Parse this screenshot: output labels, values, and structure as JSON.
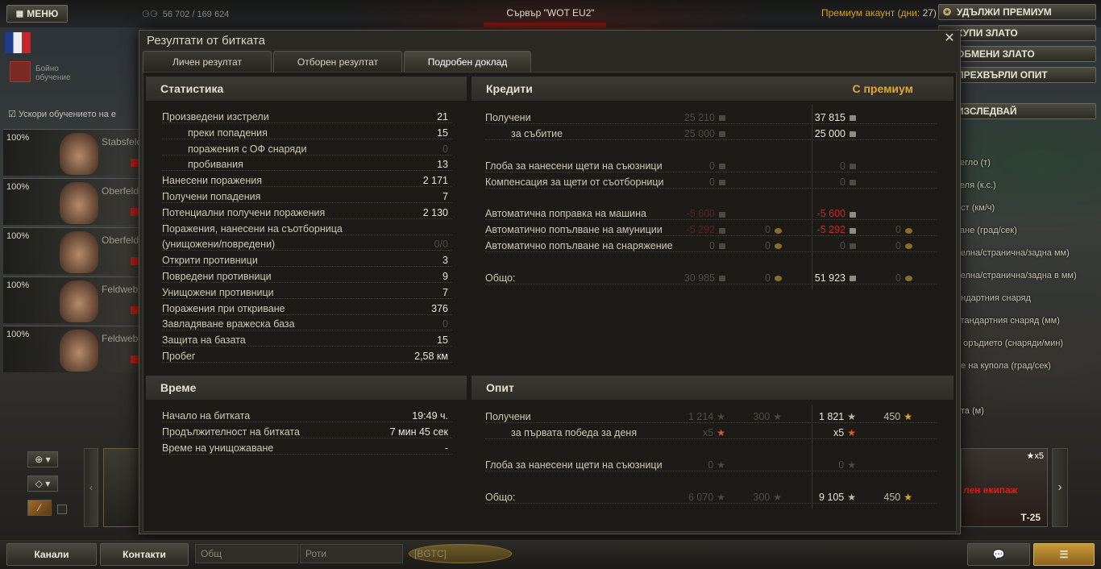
{
  "topbar": {
    "menu_label": "МЕНЮ",
    "stat_text": "56 702 / 169 624",
    "server": "Сървър \"WOT EU2\"",
    "premium_label": "Премиум акаунт (дни:",
    "premium_days": "27)"
  },
  "right_buttons": [
    "УДЪЛЖИ ПРЕМИУМ",
    "КУПИ ЗЛАТО",
    "ОБМЕНИ ЗЛАТО",
    "ПРЕХВЪРЛИ ОПИТ",
    "ИЗСЛЕДВАЙ"
  ],
  "right_items": [
    "Тегло (т)",
    "Мощност на двигателя (к.с.)",
    "Максимална скорост (км/ч)",
    "Завиване на шасито (град/сек)",
    "Бронировка (челна/странична/задна мм)",
    "Бронировка купол (челна/странична/задна в мм)",
    "Стандартни щети от стандартния снаряд",
    "Пробиване на стандартния снаряд (мм)",
    "Скорострелност на оръдието (снаряди/мин)",
    "Скорост на въртене на купола (град/сек)",
    "Обхват (м)"
  ],
  "right_items_visible": [
    "тегло (т)",
    "теля (к.с.)",
    "ост (км/ч)",
    "тане (град/сек)",
    "челна/странична/задна мм)",
    "челна/странична/задна в мм)",
    "андартния снаряд",
    "стандартния снаряд (мм)",
    "а оръдието (снаряди/мин)",
    "не на купола (град/сек)",
    "ата (м)"
  ],
  "left": {
    "training_label": "Бойно обучение",
    "speedup_label": "Ускори обучението на е",
    "crew": [
      {
        "pct": "100%",
        "rank": "Stabsfeldw"
      },
      {
        "pct": "100%",
        "rank": "Oberfeldw"
      },
      {
        "pct": "100%",
        "rank": "Oberfeldw"
      },
      {
        "pct": "100%",
        "rank": "Feldweb"
      },
      {
        "pct": "100%",
        "rank": "Feldweb"
      }
    ]
  },
  "dialog": {
    "title": "Резултати от битката",
    "tabs": [
      "Личен резултат",
      "Отборен резултат",
      "Подробен доклад"
    ],
    "active_tab": 2,
    "statistics": {
      "header": "Статистика",
      "rows": [
        {
          "label": "Произведени изстрели",
          "value": "21",
          "indent": false,
          "dim": false
        },
        {
          "label": "преки попадения",
          "value": "15",
          "indent": true,
          "dim": false
        },
        {
          "label": "поражения с ОФ снаряди",
          "value": "0",
          "indent": true,
          "dim": true
        },
        {
          "label": "пробивания",
          "value": "13",
          "indent": true,
          "dim": false
        },
        {
          "label": "Нанесени поражения",
          "value": "2 171",
          "indent": false,
          "dim": false
        },
        {
          "label": "Получени попадения",
          "value": "7",
          "indent": false,
          "dim": false
        },
        {
          "label": "Потенциални получени поражения",
          "value": "2 130",
          "indent": false,
          "dim": false
        },
        {
          "label": "Поражения, нанесени на съотборница",
          "value": "",
          "indent": false,
          "dim": false
        },
        {
          "label": "(унищожени/повредени)",
          "value": "0/0",
          "indent": false,
          "dim": true
        },
        {
          "label": "Открити противници",
          "value": "3",
          "indent": false,
          "dim": false
        },
        {
          "label": "Повредени противници",
          "value": "9",
          "indent": false,
          "dim": false
        },
        {
          "label": "Унищожени противници",
          "value": "7",
          "indent": false,
          "dim": false
        },
        {
          "label": "Поражения при откриване",
          "value": "376",
          "indent": false,
          "dim": false
        },
        {
          "label": "Завладяване вражеска база",
          "value": "0",
          "indent": false,
          "dim": true
        },
        {
          "label": "Защита на базата",
          "value": "15",
          "indent": false,
          "dim": false
        },
        {
          "label": "Пробег",
          "value": "2,58 км",
          "indent": false,
          "dim": false
        }
      ]
    },
    "time": {
      "header": "Време",
      "rows": [
        {
          "label": "Начало на битката",
          "value": "19:49 ч."
        },
        {
          "label": "Продължителност на битката",
          "value": "7 мин 45 сек"
        },
        {
          "label": "Време на унищожаване",
          "value": "-"
        }
      ]
    },
    "credits": {
      "header": "Кредити",
      "premium_header": "С премиум",
      "rows": [
        {
          "label": "Получени",
          "indent": false,
          "std": "25 210",
          "std_style": "dim",
          "std_gold": "",
          "prem": "37 815",
          "prem_style": "",
          "prem_gold": ""
        },
        {
          "label": "за събитие",
          "indent": true,
          "std": "25 000",
          "std_style": "dim",
          "std_gold": "",
          "prem": "25 000",
          "prem_style": "",
          "prem_gold": ""
        },
        {
          "label": "",
          "indent": false,
          "std": "",
          "std_style": "",
          "std_gold": "",
          "prem": "",
          "prem_style": "",
          "prem_gold": ""
        },
        {
          "label": "Глоба за нанесени щети на съюзници",
          "indent": false,
          "std": "0",
          "std_style": "dim",
          "std_gold": "",
          "prem": "0",
          "prem_style": "dim",
          "prem_gold": ""
        },
        {
          "label": "Компенсация за щети от съотборници",
          "indent": false,
          "std": "0",
          "std_style": "dim",
          "std_gold": "",
          "prem": "0",
          "prem_style": "dim",
          "prem_gold": ""
        },
        {
          "label": "",
          "indent": false,
          "std": "",
          "std_style": "",
          "std_gold": "",
          "prem": "",
          "prem_style": "",
          "prem_gold": ""
        },
        {
          "label": "Автоматична поправка на машина",
          "indent": false,
          "std": "-5 600",
          "std_style": "negdim",
          "std_gold": "",
          "prem": "-5 600",
          "prem_style": "neg",
          "prem_gold": ""
        },
        {
          "label": "Автоматично попълване на амуниции",
          "indent": false,
          "std": "-5 292",
          "std_style": "negdim",
          "std_gold": "0",
          "prem": "-5 292",
          "prem_style": "neg",
          "prem_gold": "0"
        },
        {
          "label": "Автоматично попълване на снаряжение",
          "indent": false,
          "std": "0",
          "std_style": "dim",
          "std_gold": "0",
          "prem": "0",
          "prem_style": "dim",
          "prem_gold": "0"
        },
        {
          "label": "",
          "indent": false,
          "std": "",
          "std_style": "",
          "std_gold": "",
          "prem": "",
          "prem_style": "",
          "prem_gold": ""
        },
        {
          "label": "Общо:",
          "indent": false,
          "std": "30 985",
          "std_style": "dim",
          "std_gold": "0",
          "prem": "51 923",
          "prem_style": "",
          "prem_gold": "0"
        }
      ]
    },
    "experience": {
      "header": "Опит",
      "rows": [
        {
          "label": "Получени",
          "indent": false,
          "std": "1 214",
          "std_free": "300",
          "prem": "1 821",
          "prem_free": "450"
        },
        {
          "label": "за първата победа за деня",
          "indent": true,
          "std": "x5",
          "std_free": "",
          "prem": "x5",
          "prem_free": ""
        },
        {
          "label": "",
          "indent": false,
          "std": "",
          "std_free": "",
          "prem": "",
          "prem_free": ""
        },
        {
          "label": "Глоба за нанесени щети на съюзници",
          "indent": false,
          "std": "0",
          "std_free": "",
          "prem": "0",
          "prem_free": ""
        },
        {
          "label": "",
          "indent": false,
          "std": "",
          "std_free": "",
          "prem": "",
          "prem_free": ""
        },
        {
          "label": "Общо:",
          "indent": false,
          "std": "6 070",
          "std_free": "300",
          "prem": "9 105",
          "prem_free": "450"
        }
      ]
    }
  },
  "tank": {
    "name": "Т-25",
    "crew_label": "лен екипаж",
    "multiplier": "x5"
  },
  "bottom": {
    "channels_label": "Канали",
    "contacts_label": "Контакти",
    "chan_common": "Общ",
    "chan_companies": "Роти",
    "chan_clan": "[BGTC]"
  },
  "colors": {
    "premium": "#e3a533",
    "negative": "#c8281e",
    "panel": "#1c1b18"
  }
}
